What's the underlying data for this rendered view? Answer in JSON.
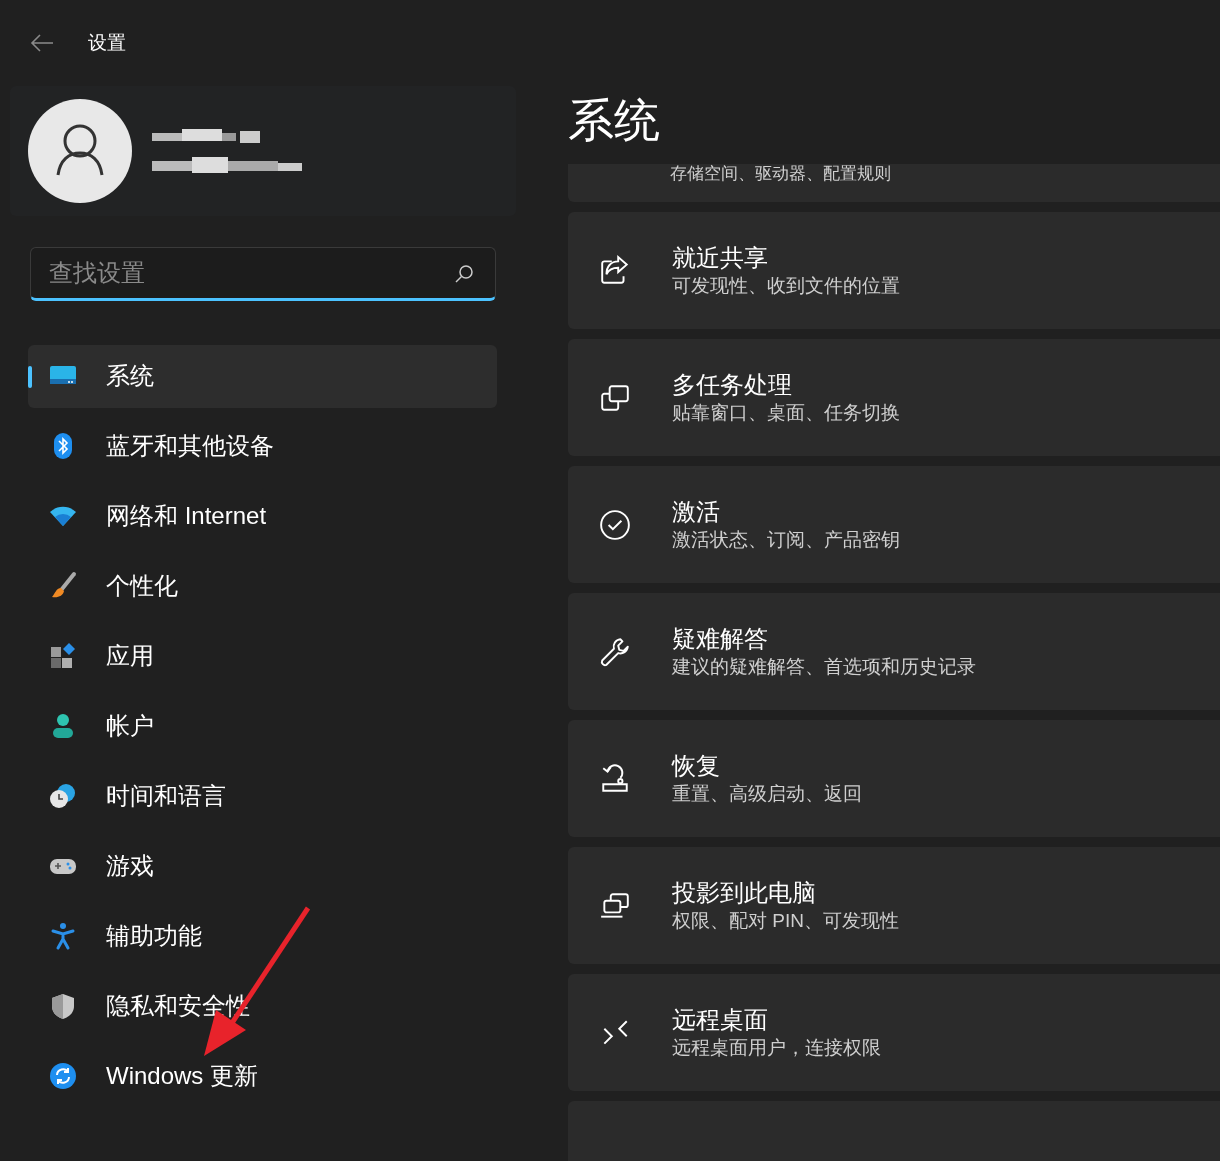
{
  "header": {
    "title": "设置"
  },
  "search": {
    "placeholder": "查找设置"
  },
  "nav": [
    {
      "label": "系统",
      "selected": true
    },
    {
      "label": "蓝牙和其他设备",
      "selected": false
    },
    {
      "label": "网络和 Internet",
      "selected": false
    },
    {
      "label": "个性化",
      "selected": false
    },
    {
      "label": "应用",
      "selected": false
    },
    {
      "label": "帐户",
      "selected": false
    },
    {
      "label": "时间和语言",
      "selected": false
    },
    {
      "label": "游戏",
      "selected": false
    },
    {
      "label": "辅助功能",
      "selected": false
    },
    {
      "label": "隐私和安全性",
      "selected": false
    },
    {
      "label": "Windows 更新",
      "selected": false
    }
  ],
  "page_title": "系统",
  "cards": [
    {
      "kind": "partial",
      "subtitle": "存储空间、驱动器、配置规则"
    },
    {
      "kind": "full",
      "title": "就近共享",
      "subtitle": "可发现性、收到文件的位置"
    },
    {
      "kind": "full",
      "title": "多任务处理",
      "subtitle": "贴靠窗口、桌面、任务切换"
    },
    {
      "kind": "full",
      "title": "激活",
      "subtitle": "激活状态、订阅、产品密钥"
    },
    {
      "kind": "full",
      "title": "疑难解答",
      "subtitle": "建议的疑难解答、首选项和历史记录"
    },
    {
      "kind": "full",
      "title": "恢复",
      "subtitle": "重置、高级启动、返回"
    },
    {
      "kind": "full",
      "title": "投影到此电脑",
      "subtitle": "权限、配对 PIN、可发现性"
    },
    {
      "kind": "full",
      "title": "远程桌面",
      "subtitle": "远程桌面用户，连接权限"
    },
    {
      "kind": "stub"
    }
  ]
}
